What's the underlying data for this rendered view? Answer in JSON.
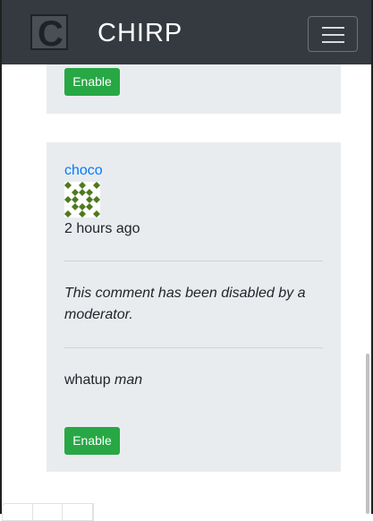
{
  "navbar": {
    "logo_letter": "C",
    "brand": "CHIRP",
    "toggler_icon": "hamburger-menu-icon"
  },
  "comments": [
    {
      "enable_label": "Enable"
    },
    {
      "author": "choco",
      "avatar_icon": "identicon-avatar",
      "avatar_color": "#4f7a1f",
      "timestamp": "2 hours ago",
      "disabled_note": "This comment has been disabled by a moderator.",
      "content_plain": "whatup ",
      "content_emph": "man",
      "enable_label": "Enable"
    }
  ],
  "colors": {
    "navbar_bg": "#343a40",
    "card_bg": "#e9ecef",
    "enable_button": "#28a745",
    "link": "#007bff"
  }
}
